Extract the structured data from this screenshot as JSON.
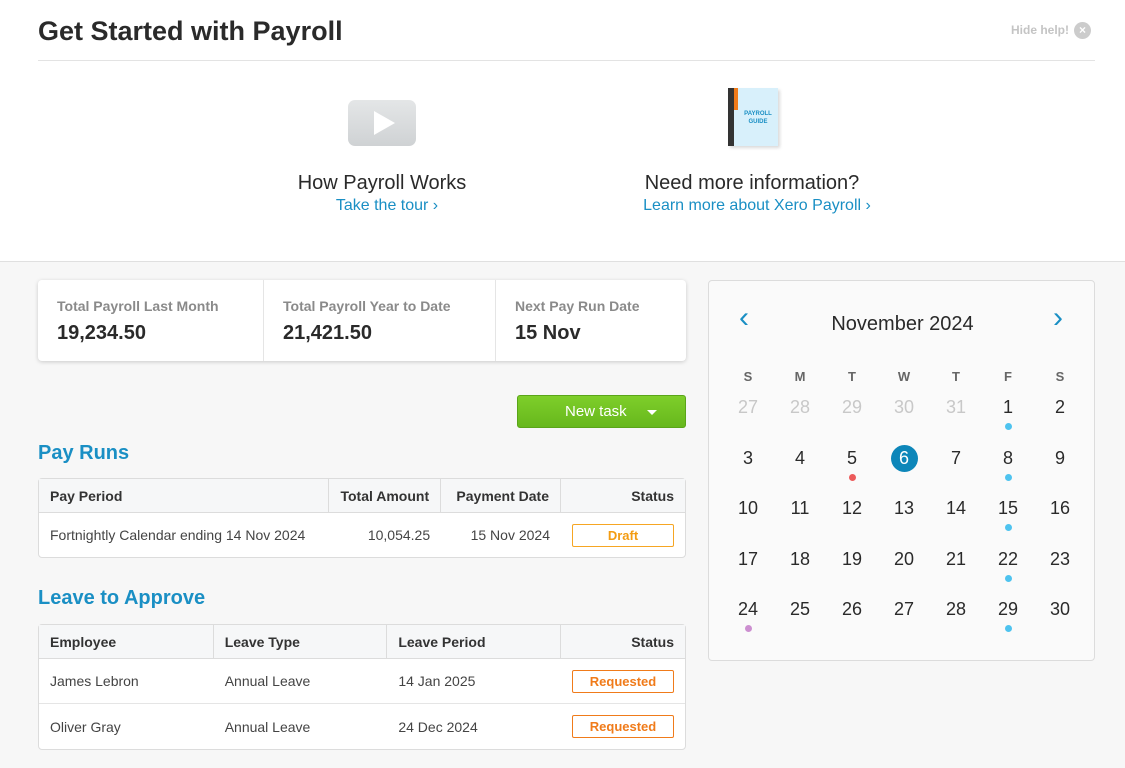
{
  "help": {
    "title": "Get Started with Payroll",
    "hide_label": "Hide help!",
    "close_icon": "x-circle-icon",
    "video": {
      "icon": "play-video-icon",
      "caption": "How Payroll Works",
      "link": "Take the tour ›"
    },
    "guide": {
      "icon": "payroll-guide-book-icon",
      "book_label": "PAYROLL GUIDE",
      "caption": "Need more information?",
      "link": "Learn more about Xero Payroll ›"
    }
  },
  "stats": [
    {
      "label": "Total Payroll Last Month",
      "value": "19,234.50"
    },
    {
      "label": "Total Payroll Year to Date",
      "value": "21,421.50"
    },
    {
      "label": "Next Pay Run Date",
      "value": "15 Nov"
    }
  ],
  "new_task": {
    "label": "New task"
  },
  "pay_runs": {
    "title": "Pay Runs",
    "columns": [
      "Pay Period",
      "Total Amount",
      "Payment Date",
      "Status"
    ],
    "rows": [
      {
        "period": "Fortnightly Calendar ending 14 Nov 2024",
        "amount": "10,054.25",
        "date": "15 Nov 2024",
        "status": "Draft"
      }
    ]
  },
  "leave": {
    "title": "Leave to Approve",
    "columns": [
      "Employee",
      "Leave Type",
      "Leave Period",
      "Status"
    ],
    "rows": [
      {
        "employee": "James Lebron",
        "type": "Annual Leave",
        "period": "14 Jan 2025",
        "status": "Requested"
      },
      {
        "employee": "Oliver Gray",
        "type": "Annual Leave",
        "period": "24 Dec 2024",
        "status": "Requested"
      }
    ]
  },
  "calendar": {
    "title": "November 2024",
    "prev_icon": "chevron-left-icon",
    "next_icon": "chevron-right-icon",
    "weekdays": [
      "S",
      "M",
      "T",
      "W",
      "T",
      "F",
      "S"
    ],
    "today": 6,
    "dot_colors": {
      "blue": "#4ec3ef",
      "red": "#ec5a5a",
      "purple": "#cc8fd0"
    },
    "weeks": [
      [
        {
          "d": "27",
          "muted": true
        },
        {
          "d": "28",
          "muted": true
        },
        {
          "d": "29",
          "muted": true
        },
        {
          "d": "30",
          "muted": true
        },
        {
          "d": "31",
          "muted": true
        },
        {
          "d": "1",
          "dot": "blue"
        },
        {
          "d": "2"
        }
      ],
      [
        {
          "d": "3"
        },
        {
          "d": "4"
        },
        {
          "d": "5",
          "dot": "red"
        },
        {
          "d": "6",
          "today": true
        },
        {
          "d": "7"
        },
        {
          "d": "8",
          "dot": "blue"
        },
        {
          "d": "9"
        }
      ],
      [
        {
          "d": "10"
        },
        {
          "d": "11"
        },
        {
          "d": "12"
        },
        {
          "d": "13"
        },
        {
          "d": "14"
        },
        {
          "d": "15",
          "dot": "blue"
        },
        {
          "d": "16"
        }
      ],
      [
        {
          "d": "17"
        },
        {
          "d": "18"
        },
        {
          "d": "19"
        },
        {
          "d": "20"
        },
        {
          "d": "21"
        },
        {
          "d": "22",
          "dot": "blue"
        },
        {
          "d": "23"
        }
      ],
      [
        {
          "d": "24",
          "dot": "purple"
        },
        {
          "d": "25"
        },
        {
          "d": "26"
        },
        {
          "d": "27"
        },
        {
          "d": "28"
        },
        {
          "d": "29",
          "dot": "blue"
        },
        {
          "d": "30"
        }
      ]
    ]
  }
}
